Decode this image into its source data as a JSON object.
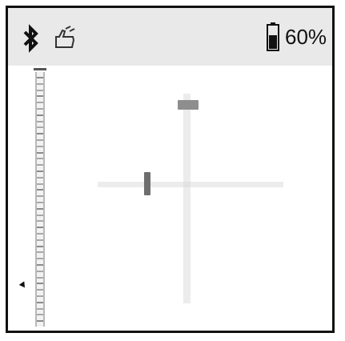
{
  "status_bar": {
    "battery_text": "60%",
    "battery_level": 0.6,
    "icons": {
      "bluetooth": "bluetooth-icon",
      "tilt": "hand-tilt-icon",
      "battery": "battery-icon"
    }
  },
  "level_display": {
    "ruler": "scale-ruler",
    "crosshair": "crosshair"
  },
  "colors": {
    "status_bar_bg": "#e9e9e9",
    "frame": "#111111",
    "indicator_vertical": "#8e8e8e",
    "indicator_horizontal": "#6e6e6e"
  }
}
